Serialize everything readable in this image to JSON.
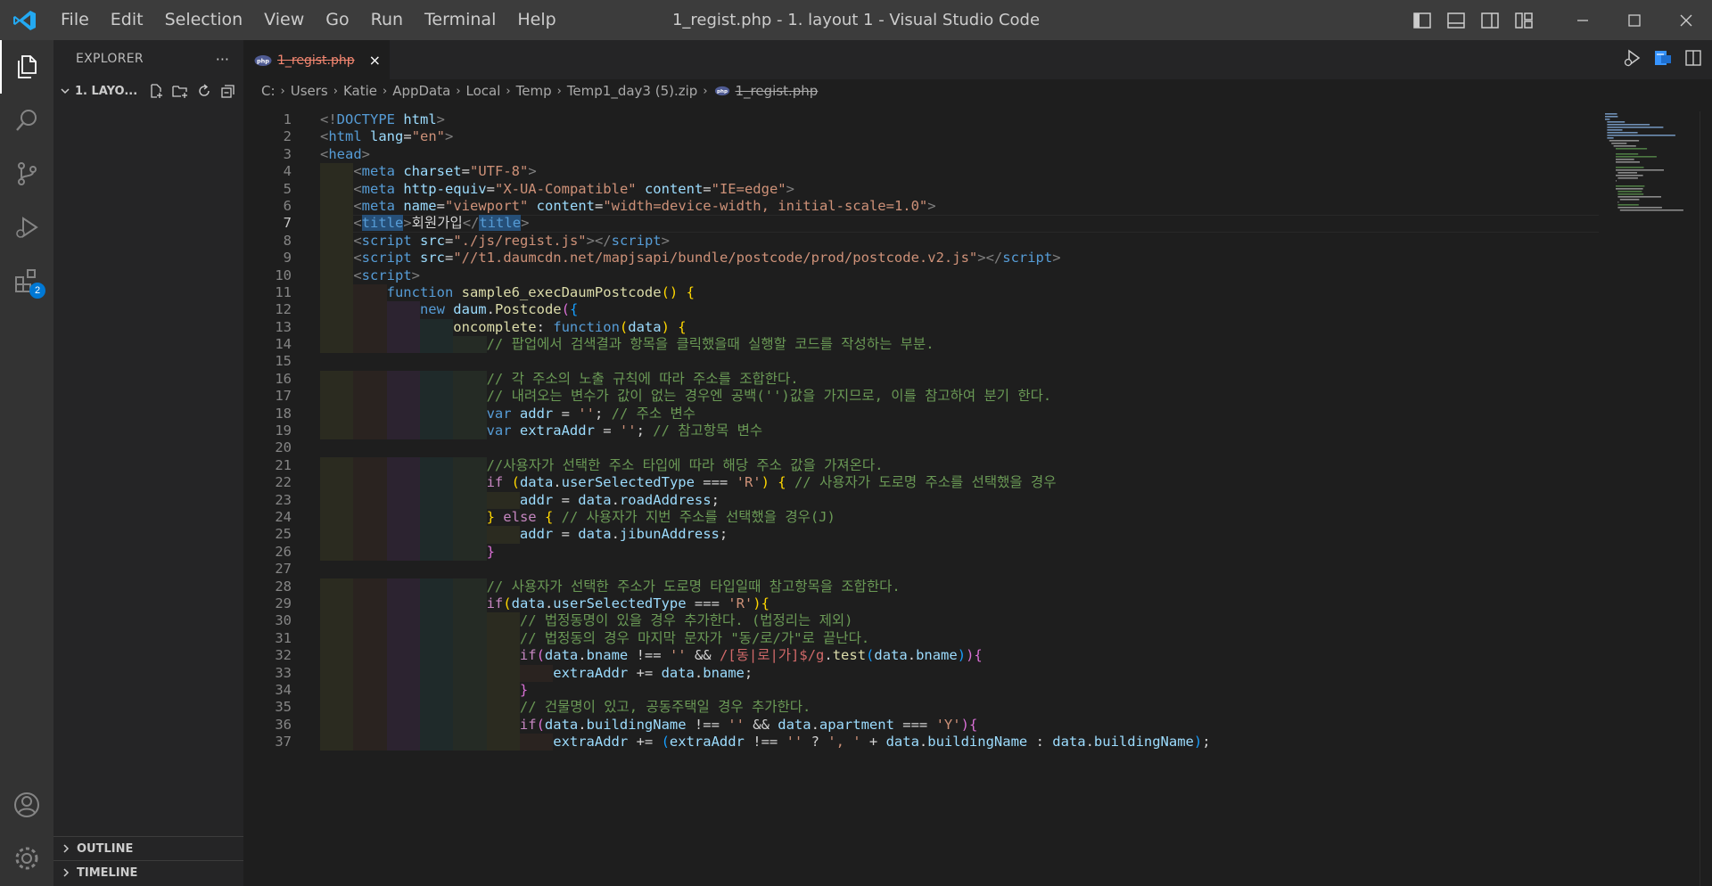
{
  "window": {
    "title": "1_regist.php - 1. layout 1 - Visual Studio Code"
  },
  "menu": [
    "File",
    "Edit",
    "Selection",
    "View",
    "Go",
    "Run",
    "Terminal",
    "Help"
  ],
  "activity": {
    "extensions_badge": "2"
  },
  "sidebar": {
    "title": "EXPLORER",
    "more": "···",
    "folder": "1. LAYO...",
    "sections": {
      "outline": "OUTLINE",
      "timeline": "TIMELINE"
    }
  },
  "tab": {
    "label": "1_regist.php",
    "close": "×"
  },
  "breadcrumb": [
    "C:",
    "Users",
    "Katie",
    "AppData",
    "Local",
    "Temp",
    "Temp1_day3 (5).zip"
  ],
  "breadcrumb_file": "1_regist.php",
  "editor": {
    "current_line": 7,
    "lines": [
      {
        "n": "1",
        "indent": 0,
        "t": [
          [
            "tag",
            "<!"
          ],
          [
            "name",
            "DOCTYPE"
          ],
          [
            "",
            "",
            ""
          ],
          [
            "attr",
            " html"
          ],
          [
            "tag",
            ">"
          ]
        ]
      },
      {
        "n": "2",
        "indent": 0,
        "t": [
          [
            "tag",
            "<"
          ],
          [
            "name",
            "html"
          ],
          [
            "attr",
            " lang"
          ],
          [
            "",
            "="
          ],
          [
            "str",
            "\"en\""
          ],
          [
            "tag",
            ">"
          ]
        ]
      },
      {
        "n": "3",
        "indent": 0,
        "t": [
          [
            "tag",
            "<"
          ],
          [
            "name",
            "head"
          ],
          [
            "tag",
            ">"
          ]
        ]
      },
      {
        "n": "4",
        "indent": 1,
        "t": [
          [
            "tag",
            "<"
          ],
          [
            "name",
            "meta"
          ],
          [
            "attr",
            " charset"
          ],
          [
            "",
            "="
          ],
          [
            "str",
            "\"UTF-8\""
          ],
          [
            "tag",
            ">"
          ]
        ]
      },
      {
        "n": "5",
        "indent": 1,
        "t": [
          [
            "tag",
            "<"
          ],
          [
            "name",
            "meta"
          ],
          [
            "attr",
            " http-equiv"
          ],
          [
            "",
            "="
          ],
          [
            "str",
            "\"X-UA-Compatible\""
          ],
          [
            "attr",
            " content"
          ],
          [
            "",
            "="
          ],
          [
            "str",
            "\"IE=edge\""
          ],
          [
            "tag",
            ">"
          ]
        ]
      },
      {
        "n": "6",
        "indent": 1,
        "t": [
          [
            "tag",
            "<"
          ],
          [
            "name",
            "meta"
          ],
          [
            "attr",
            " name"
          ],
          [
            "",
            "="
          ],
          [
            "str",
            "\"viewport\""
          ],
          [
            "attr",
            " content"
          ],
          [
            "",
            "="
          ],
          [
            "str",
            "\"width=device-width, initial-scale=1.0\""
          ],
          [
            "tag",
            ">"
          ]
        ]
      },
      {
        "n": "7",
        "indent": 1,
        "t": [
          [
            "tag",
            "<"
          ],
          [
            "namehl",
            "title"
          ],
          [
            "tag",
            ">"
          ],
          [
            "",
            "회원가입"
          ],
          [
            "tag",
            "</"
          ],
          [
            "namehl",
            "title"
          ],
          [
            "tag",
            ">"
          ]
        ]
      },
      {
        "n": "8",
        "indent": 1,
        "t": [
          [
            "tag",
            "<"
          ],
          [
            "name",
            "script"
          ],
          [
            "attr",
            " src"
          ],
          [
            "",
            "="
          ],
          [
            "str",
            "\"./js/regist.js\""
          ],
          [
            "tag",
            "></"
          ],
          [
            "name",
            "script"
          ],
          [
            "tag",
            ">"
          ]
        ]
      },
      {
        "n": "9",
        "indent": 1,
        "t": [
          [
            "tag",
            "<"
          ],
          [
            "name",
            "script"
          ],
          [
            "attr",
            " src"
          ],
          [
            "",
            "="
          ],
          [
            "str",
            "\"//t1.daumcdn.net/mapjsapi/bundle/postcode/prod/postcode.v2.js\""
          ],
          [
            "tag",
            "></"
          ],
          [
            "name",
            "script"
          ],
          [
            "tag",
            ">"
          ]
        ]
      },
      {
        "n": "10",
        "indent": 1,
        "t": [
          [
            "tag",
            "<"
          ],
          [
            "name",
            "script"
          ],
          [
            "tag",
            ">"
          ]
        ]
      },
      {
        "n": "11",
        "indent": 2,
        "t": [
          [
            "kw",
            "function"
          ],
          [
            "fn",
            " sample6_execDaumPostcode"
          ],
          [
            "p1",
            "()"
          ],
          [
            "",
            " "
          ],
          [
            "p1",
            "{"
          ]
        ]
      },
      {
        "n": "12",
        "indent": 3,
        "t": [
          [
            "kw",
            "new"
          ],
          [
            "var",
            " daum"
          ],
          [
            "",
            "."
          ],
          [
            "fn",
            "Postcode"
          ],
          [
            "p2",
            "("
          ],
          [
            "p3",
            "{"
          ]
        ]
      },
      {
        "n": "13",
        "indent": 4,
        "t": [
          [
            "fn",
            "oncomplete"
          ],
          [
            "",
            ": "
          ],
          [
            "kw",
            "function"
          ],
          [
            "p1",
            "("
          ],
          [
            "var",
            "data"
          ],
          [
            "p1",
            ")"
          ],
          [
            "",
            " "
          ],
          [
            "p1",
            "{"
          ]
        ]
      },
      {
        "n": "14",
        "indent": 5,
        "t": [
          [
            "cm",
            "// 팝업에서 검색결과 항목을 클릭했을때 실행할 코드를 작성하는 부분."
          ]
        ]
      },
      {
        "n": "15",
        "indent": 0,
        "t": []
      },
      {
        "n": "16",
        "indent": 5,
        "t": [
          [
            "cm",
            "// 각 주소의 노출 규칙에 따라 주소를 조합한다."
          ]
        ]
      },
      {
        "n": "17",
        "indent": 5,
        "t": [
          [
            "cm",
            "// 내려오는 변수가 값이 없는 경우엔 공백('')값을 가지므로, 이를 참고하여 분기 한다."
          ]
        ]
      },
      {
        "n": "18",
        "indent": 5,
        "t": [
          [
            "kw",
            "var"
          ],
          [
            "var",
            " addr"
          ],
          [
            "",
            " = "
          ],
          [
            "str",
            "''"
          ],
          [
            "",
            ";"
          ],
          [
            "cm",
            " // 주소 변수"
          ]
        ]
      },
      {
        "n": "19",
        "indent": 5,
        "t": [
          [
            "kw",
            "var"
          ],
          [
            "var",
            " extraAddr"
          ],
          [
            "",
            " = "
          ],
          [
            "str",
            "''"
          ],
          [
            "",
            ";"
          ],
          [
            "cm",
            " // 참고항목 변수"
          ]
        ]
      },
      {
        "n": "20",
        "indent": 0,
        "t": []
      },
      {
        "n": "21",
        "indent": 5,
        "t": [
          [
            "cm",
            "//사용자가 선택한 주소 타입에 따라 해당 주소 값을 가져온다."
          ]
        ]
      },
      {
        "n": "22",
        "indent": 5,
        "t": [
          [
            "ctrl",
            "if"
          ],
          [
            "",
            " "
          ],
          [
            "p1",
            "("
          ],
          [
            "var",
            "data"
          ],
          [
            "",
            "."
          ],
          [
            "var",
            "userSelectedType"
          ],
          [
            "",
            " === "
          ],
          [
            "str",
            "'R'"
          ],
          [
            "p1",
            ")"
          ],
          [
            "",
            " "
          ],
          [
            "p1",
            "{"
          ],
          [
            "cm",
            " // 사용자가 도로명 주소를 선택했을 경우"
          ]
        ]
      },
      {
        "n": "23",
        "indent": 6,
        "t": [
          [
            "var",
            "addr"
          ],
          [
            "",
            " = "
          ],
          [
            "var",
            "data"
          ],
          [
            "",
            "."
          ],
          [
            "var",
            "roadAddress"
          ],
          [
            "",
            ";"
          ]
        ]
      },
      {
        "n": "24",
        "indent": 5,
        "t": [
          [
            "p1",
            "}"
          ],
          [
            "",
            " "
          ],
          [
            "ctrl",
            "else"
          ],
          [
            "",
            " "
          ],
          [
            "p1",
            "{"
          ],
          [
            "cm",
            " // 사용자가 지번 주소를 선택했을 경우(J)"
          ]
        ]
      },
      {
        "n": "25",
        "indent": 6,
        "t": [
          [
            "var",
            "addr"
          ],
          [
            "",
            " = "
          ],
          [
            "var",
            "data"
          ],
          [
            "",
            "."
          ],
          [
            "var",
            "jibunAddress"
          ],
          [
            "",
            ";"
          ]
        ]
      },
      {
        "n": "26",
        "indent": 5,
        "t": [
          [
            "p2",
            "}"
          ]
        ]
      },
      {
        "n": "27",
        "indent": 0,
        "t": []
      },
      {
        "n": "28",
        "indent": 5,
        "t": [
          [
            "cm",
            "// 사용자가 선택한 주소가 도로명 타입일때 참고항목을 조합한다."
          ]
        ]
      },
      {
        "n": "29",
        "indent": 5,
        "t": [
          [
            "ctrl",
            "if"
          ],
          [
            "p1",
            "("
          ],
          [
            "var",
            "data"
          ],
          [
            "",
            "."
          ],
          [
            "var",
            "userSelectedType"
          ],
          [
            "",
            " === "
          ],
          [
            "str",
            "'R'"
          ],
          [
            "p1",
            ")"
          ],
          [
            "p1",
            "{"
          ]
        ]
      },
      {
        "n": "30",
        "indent": 6,
        "t": [
          [
            "cm",
            "// 법정동명이 있을 경우 추가한다. (법정리는 제외)"
          ]
        ]
      },
      {
        "n": "31",
        "indent": 6,
        "t": [
          [
            "cm",
            "// 법정동의 경우 마지막 문자가 \"동/로/가\"로 끝난다."
          ]
        ]
      },
      {
        "n": "32",
        "indent": 6,
        "t": [
          [
            "ctrl",
            "if"
          ],
          [
            "p2",
            "("
          ],
          [
            "var",
            "data"
          ],
          [
            "",
            "."
          ],
          [
            "var",
            "bname"
          ],
          [
            "",
            " !== "
          ],
          [
            "str",
            "''"
          ],
          [
            "",
            " && "
          ],
          [
            "re",
            "/[동|로|가]$/g"
          ],
          [
            "",
            "."
          ],
          [
            "fn",
            "test"
          ],
          [
            "p3",
            "("
          ],
          [
            "var",
            "data"
          ],
          [
            "",
            "."
          ],
          [
            "var",
            "bname"
          ],
          [
            "p3",
            ")"
          ],
          [
            "p2",
            ")"
          ],
          [
            "p2",
            "{"
          ]
        ]
      },
      {
        "n": "33",
        "indent": 7,
        "t": [
          [
            "var",
            "extraAddr"
          ],
          [
            "",
            " += "
          ],
          [
            "var",
            "data"
          ],
          [
            "",
            "."
          ],
          [
            "var",
            "bname"
          ],
          [
            "",
            ";"
          ]
        ]
      },
      {
        "n": "34",
        "indent": 6,
        "t": [
          [
            "p2",
            "}"
          ]
        ]
      },
      {
        "n": "35",
        "indent": 6,
        "t": [
          [
            "cm",
            "// 건물명이 있고, 공동주택일 경우 추가한다."
          ]
        ]
      },
      {
        "n": "36",
        "indent": 6,
        "t": [
          [
            "ctrl",
            "if"
          ],
          [
            "p2",
            "("
          ],
          [
            "var",
            "data"
          ],
          [
            "",
            "."
          ],
          [
            "var",
            "buildingName"
          ],
          [
            "",
            " !== "
          ],
          [
            "str",
            "''"
          ],
          [
            "",
            " && "
          ],
          [
            "var",
            "data"
          ],
          [
            "",
            "."
          ],
          [
            "var",
            "apartment"
          ],
          [
            "",
            " === "
          ],
          [
            "str",
            "'Y'"
          ],
          [
            "p2",
            ")"
          ],
          [
            "p2",
            "{"
          ]
        ]
      },
      {
        "n": "37",
        "indent": 7,
        "t": [
          [
            "var",
            "extraAddr"
          ],
          [
            "",
            " += "
          ],
          [
            "p3",
            "("
          ],
          [
            "var",
            "extraAddr"
          ],
          [
            "",
            " !== "
          ],
          [
            "str",
            "''"
          ],
          [
            "",
            " ? "
          ],
          [
            "str",
            "', '"
          ],
          [
            "",
            " + "
          ],
          [
            "var",
            "data"
          ],
          [
            "",
            "."
          ],
          [
            "var",
            "buildingName"
          ],
          [
            "",
            " : "
          ],
          [
            "var",
            "data"
          ],
          [
            "",
            "."
          ],
          [
            "var",
            "buildingName"
          ],
          [
            "p3",
            ")"
          ],
          [
            "",
            ";"
          ]
        ]
      }
    ]
  },
  "colors": {
    "guides": [
      "#2b2b20",
      "#2a2320",
      "#2c2330",
      "#1f2a2a",
      "#252b25",
      "#2b2b20",
      "#2a2320",
      "#2c2330"
    ],
    "accent": "#0078d4"
  }
}
